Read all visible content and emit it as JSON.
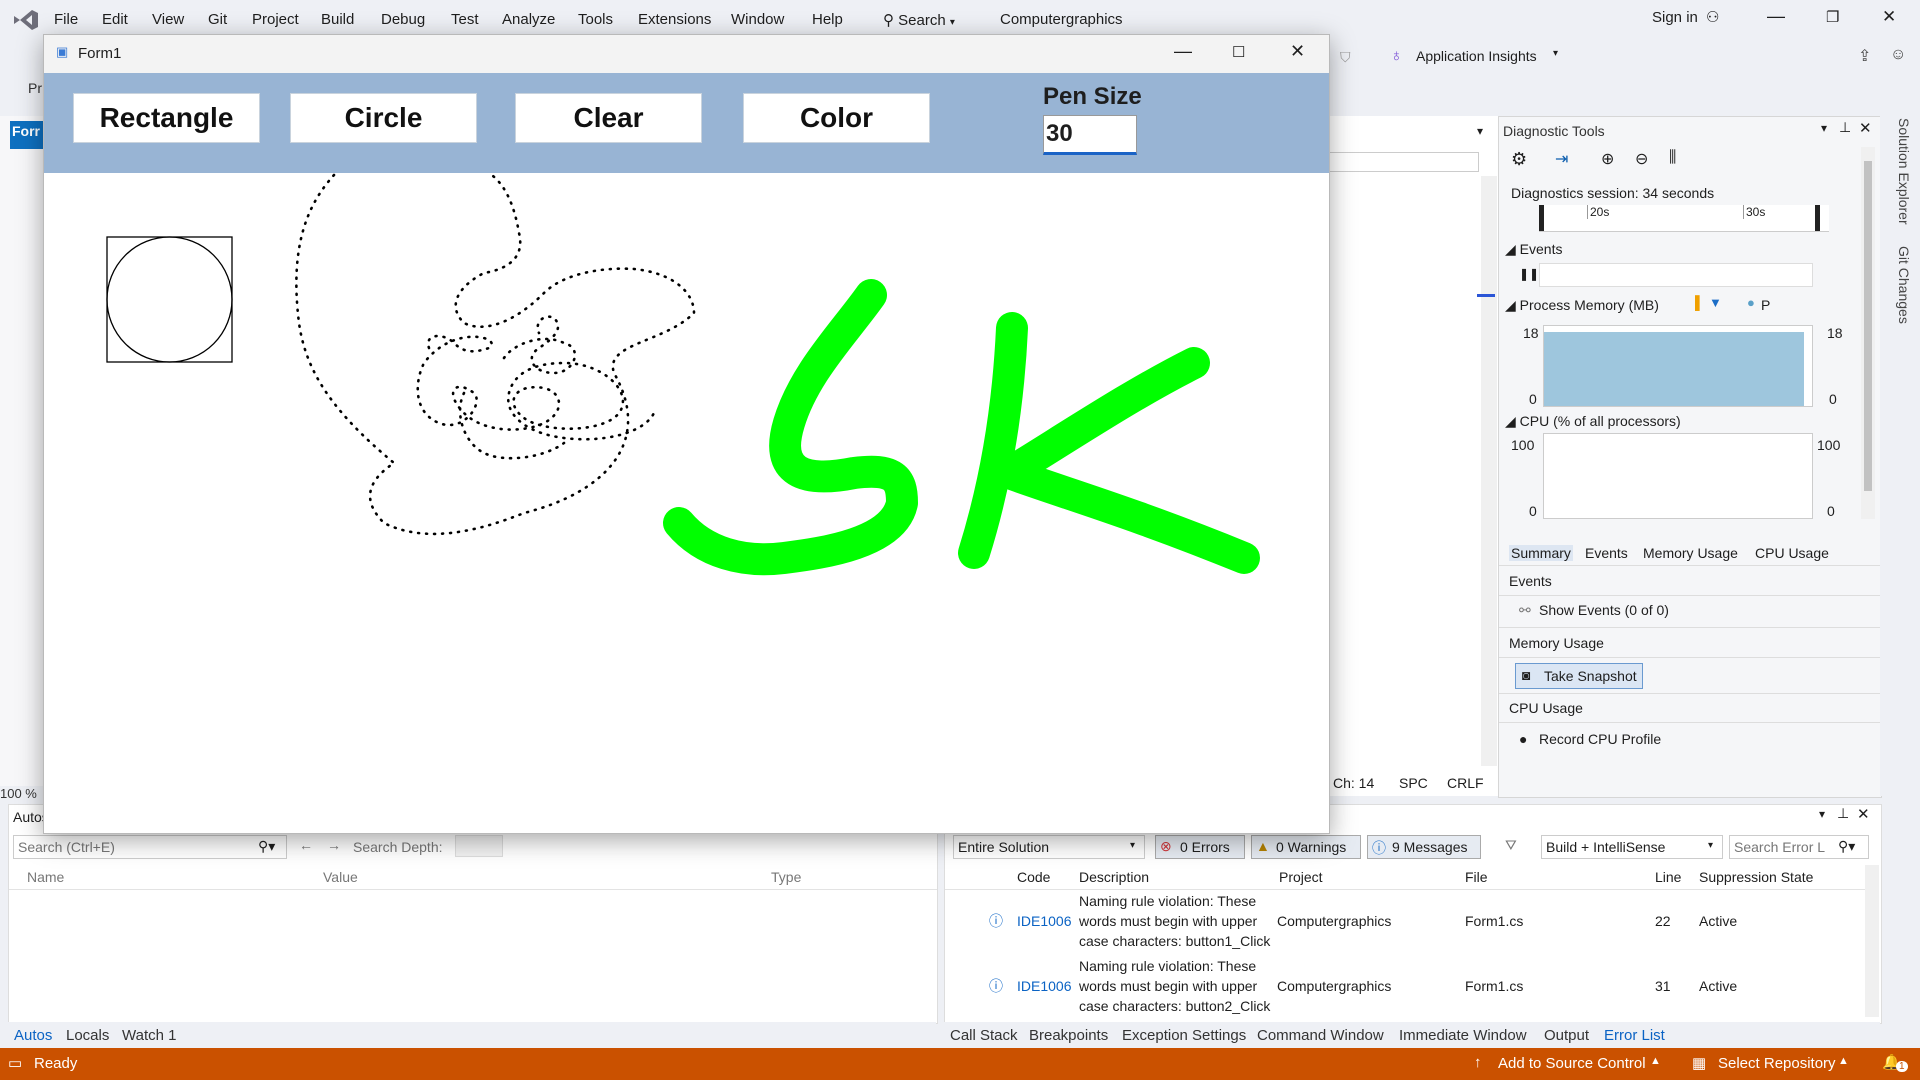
{
  "menu": [
    "File",
    "Edit",
    "View",
    "Git",
    "Project",
    "Build",
    "Debug",
    "Test",
    "Analyze",
    "Tools",
    "Extensions",
    "Window",
    "Help"
  ],
  "search": {
    "label": "Search"
  },
  "solution_name": "Computergraphics",
  "sign_in": "Sign in",
  "app_insights": "Application Insights",
  "left_stub": {
    "tab": "Forr",
    "toolbar_text": "Pr",
    "zoom": "100 %"
  },
  "form": {
    "title": "Form1",
    "buttons": {
      "rectangle": "Rectangle",
      "circle": "Circle",
      "clear": "Clear",
      "color": "Color"
    },
    "pen_size_label": "Pen Size",
    "pen_size_value": "30",
    "canvas_text": "SK",
    "stroke_color": "#00ff00"
  },
  "editor_status": {
    "ch": "Ch: 14",
    "spc": "SPC",
    "crlf": "CRLF"
  },
  "diagnostics": {
    "title": "Diagnostic Tools",
    "session": "Diagnostics session: 34 seconds",
    "timeline_ticks": [
      "20s",
      "30s"
    ],
    "events_header": "Events",
    "memory_header": "Process Memory (MB)",
    "memory_legend_letter": "P",
    "memory_max": "18",
    "memory_min": "0",
    "cpu_header": "CPU (% of all processors)",
    "cpu_max": "100",
    "cpu_min": "0",
    "tabs": [
      "Summary",
      "Events",
      "Memory Usage",
      "CPU Usage"
    ],
    "sections": {
      "events": "Events",
      "show_events": "Show Events (0 of 0)",
      "memory_usage": "Memory Usage",
      "take_snapshot": "Take Snapshot",
      "cpu_usage": "CPU Usage",
      "record_cpu": "Record CPU Profile"
    }
  },
  "side_tabs": [
    "Solution Explorer",
    "Git Changes"
  ],
  "autos": {
    "title": "Autos",
    "search_placeholder": "Search (Ctrl+E)",
    "search_depth": "Search Depth:",
    "columns": [
      "Name",
      "Value",
      "Type"
    ]
  },
  "error_list": {
    "scope": "Entire Solution",
    "errors": "0 Errors",
    "warnings": "0 Warnings",
    "messages": "9 Messages",
    "build_filter": "Build + IntelliSense",
    "search_placeholder": "Search Error L",
    "columns": [
      "Code",
      "Description",
      "Project",
      "File",
      "Line",
      "Suppression State"
    ],
    "rows": [
      {
        "code": "IDE1006",
        "desc1": "Naming rule violation: These",
        "desc2": "words must begin with upper",
        "desc3": "case characters: button1_Click",
        "project": "Computergraphics",
        "file": "Form1.cs",
        "line": "22",
        "state": "Active"
      },
      {
        "code": "IDE1006",
        "desc1": "Naming rule violation: These",
        "desc2": "words must begin with upper",
        "desc3": "case characters: button2_Click",
        "project": "Computergraphics",
        "file": "Form1.cs",
        "line": "31",
        "state": "Active"
      }
    ]
  },
  "bottom_tabs_left": [
    "Autos",
    "Locals",
    "Watch 1"
  ],
  "bottom_tabs_right": [
    "Call Stack",
    "Breakpoints",
    "Exception Settings",
    "Command Window",
    "Immediate Window",
    "Output",
    "Error List"
  ],
  "status": {
    "ready": "Ready",
    "add_source": "Add to Source Control",
    "select_repo": "Select Repository",
    "notif": "1"
  }
}
